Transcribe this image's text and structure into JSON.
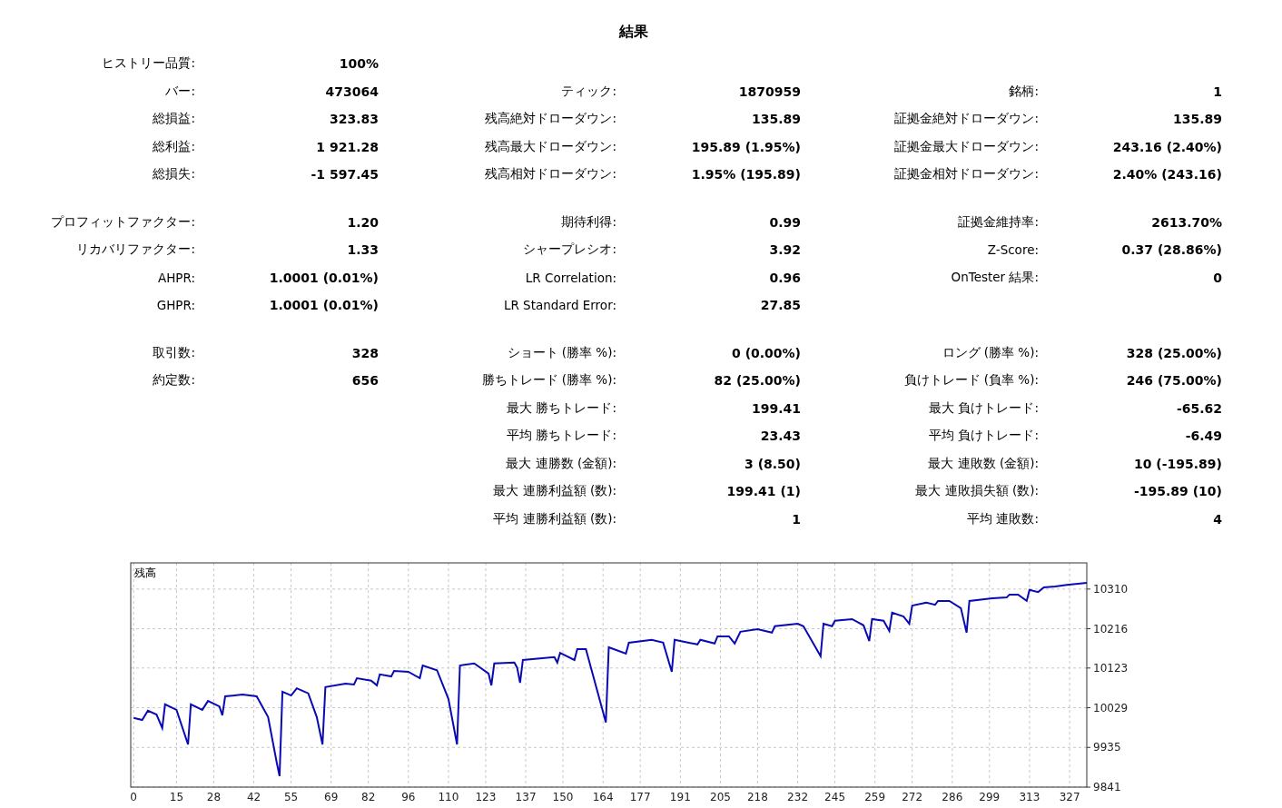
{
  "title": "結果",
  "groups": [
    {
      "rows": [
        {
          "cells": [
            {
              "label": "ヒストリー品質:",
              "value": "100%"
            },
            null,
            null
          ]
        },
        {
          "cells": [
            {
              "label": "バー:",
              "value": "473064"
            },
            {
              "label": "ティック:",
              "value": "1870959"
            },
            {
              "label": "銘柄:",
              "value": "1"
            }
          ]
        },
        {
          "cells": [
            {
              "label": "総損益:",
              "value": "323.83"
            },
            {
              "label": "残高絶対ドローダウン:",
              "value": "135.89"
            },
            {
              "label": "証拠金絶対ドローダウン:",
              "value": "135.89"
            }
          ]
        },
        {
          "cells": [
            {
              "label": "総利益:",
              "value": "1 921.28"
            },
            {
              "label": "残高最大ドローダウン:",
              "value": "195.89 (1.95%)"
            },
            {
              "label": "証拠金最大ドローダウン:",
              "value": "243.16 (2.40%)"
            }
          ]
        },
        {
          "cells": [
            {
              "label": "総損失:",
              "value": "-1 597.45"
            },
            {
              "label": "残高相対ドローダウン:",
              "value": "1.95% (195.89)"
            },
            {
              "label": "証拠金相対ドローダウン:",
              "value": "2.40% (243.16)"
            }
          ]
        }
      ]
    },
    {
      "rows": [
        {
          "cells": [
            {
              "label": "プロフィットファクター:",
              "value": "1.20"
            },
            {
              "label": "期待利得:",
              "value": "0.99"
            },
            {
              "label": "証拠金維持率:",
              "value": "2613.70%"
            }
          ]
        },
        {
          "cells": [
            {
              "label": "リカバリファクター:",
              "value": "1.33"
            },
            {
              "label": "シャープレシオ:",
              "value": "3.92"
            },
            {
              "label": "Z-Score:",
              "value": "0.37 (28.86%)"
            }
          ]
        },
        {
          "cells": [
            {
              "label": "AHPR:",
              "value": "1.0001 (0.01%)"
            },
            {
              "label": "LR Correlation:",
              "value": "0.96"
            },
            {
              "label": "OnTester 結果:",
              "value": "0"
            }
          ]
        },
        {
          "cells": [
            {
              "label": "GHPR:",
              "value": "1.0001 (0.01%)"
            },
            {
              "label": "LR Standard Error:",
              "value": "27.85"
            },
            null
          ]
        }
      ]
    },
    {
      "rows": [
        {
          "cells": [
            {
              "label": "取引数:",
              "value": "328"
            },
            {
              "label": "ショート (勝率 %):",
              "value": "0 (0.00%)"
            },
            {
              "label": "ロング (勝率 %):",
              "value": "328 (25.00%)"
            }
          ]
        },
        {
          "cells": [
            {
              "label": "約定数:",
              "value": "656"
            },
            {
              "label": "勝ちトレード (勝率 %):",
              "value": "82 (25.00%)"
            },
            {
              "label": "負けトレード (負率 %):",
              "value": "246 (75.00%)"
            }
          ]
        },
        {
          "cells": [
            null,
            {
              "label": "最大 勝ちトレード:",
              "value": "199.41"
            },
            {
              "label": "最大 負けトレード:",
              "value": "-65.62"
            }
          ]
        },
        {
          "cells": [
            null,
            {
              "label": "平均 勝ちトレード:",
              "value": "23.43"
            },
            {
              "label": "平均 負けトレード:",
              "value": "-6.49"
            }
          ]
        },
        {
          "cells": [
            null,
            {
              "label": "最大 連勝数 (金額):",
              "value": "3 (8.50)"
            },
            {
              "label": "最大 連敗数 (金額):",
              "value": "10 (-195.89)"
            }
          ]
        },
        {
          "cells": [
            null,
            {
              "label": "最大 連勝利益額 (数):",
              "value": "199.41 (1)"
            },
            {
              "label": "最大 連敗損失額 (数):",
              "value": "-195.89 (10)"
            }
          ]
        },
        {
          "cells": [
            null,
            {
              "label": "平均 連勝利益額 (数):",
              "value": "1"
            },
            {
              "label": "平均 連敗数:",
              "value": "4"
            }
          ]
        }
      ]
    }
  ],
  "chart": {
    "chart_data": {
      "type": "line",
      "grid": true,
      "xlim": [
        -1,
        333
      ],
      "ylim": [
        9841,
        10372
      ],
      "xticks": [
        0,
        15,
        28,
        42,
        55,
        69,
        82,
        96,
        110,
        123,
        137,
        150,
        164,
        177,
        191,
        205,
        218,
        232,
        245,
        259,
        272,
        286,
        299,
        313,
        327
      ],
      "yticks": [
        9841,
        9935,
        10029,
        10123,
        10216,
        10310
      ],
      "x": [
        0,
        3,
        5,
        8,
        10,
        11,
        15,
        19,
        20,
        24,
        26,
        30,
        31,
        32,
        38,
        43,
        47,
        50,
        51,
        52,
        55,
        57,
        61,
        64,
        66,
        67,
        74,
        77,
        78,
        83,
        85,
        86,
        90,
        91,
        96,
        100,
        101,
        106,
        110,
        113,
        114,
        119,
        124,
        125,
        126,
        133,
        134,
        135,
        136,
        147,
        148,
        149,
        154,
        155,
        158,
        165,
        166,
        172,
        173,
        181,
        185,
        188,
        189,
        194,
        197,
        198,
        203,
        204,
        208,
        210,
        212,
        218,
        223,
        224,
        232,
        234,
        240,
        241,
        244,
        245,
        251,
        255,
        257,
        258,
        262,
        264,
        265,
        269,
        271,
        272,
        277,
        280,
        281,
        285,
        289,
        291,
        292,
        300,
        305,
        306,
        309,
        312,
        313,
        316,
        318,
        322,
        326,
        333
      ],
      "series": [
        {
          "name": "残高",
          "color": "#0a0ab4",
          "values": [
            10005,
            10000,
            10022,
            10013,
            9981,
            10037,
            10024,
            9942,
            10037,
            10024,
            10045,
            10032,
            10011,
            10056,
            10060,
            10056,
            10007,
            9899,
            9867,
            10067,
            10058,
            10075,
            10063,
            10007,
            9942,
            10078,
            10086,
            10084,
            10099,
            10093,
            10082,
            10108,
            10103,
            10116,
            10114,
            10099,
            10129,
            10118,
            10050,
            9942,
            10129,
            10134,
            10110,
            10082,
            10134,
            10136,
            10124,
            10088,
            10142,
            10149,
            10136,
            10159,
            10142,
            10168,
            10168,
            9994,
            10172,
            10157,
            10183,
            10190,
            10183,
            10114,
            10190,
            10183,
            10179,
            10190,
            10181,
            10198,
            10198,
            10181,
            10209,
            10215,
            10207,
            10222,
            10228,
            10222,
            10151,
            10228,
            10222,
            10235,
            10239,
            10224,
            10187,
            10239,
            10235,
            10211,
            10254,
            10245,
            10228,
            10271,
            10278,
            10273,
            10282,
            10282,
            10265,
            10207,
            10282,
            10288,
            10290,
            10297,
            10297,
            10282,
            10308,
            10303,
            10314,
            10316,
            10320,
            10325
          ]
        }
      ]
    }
  }
}
